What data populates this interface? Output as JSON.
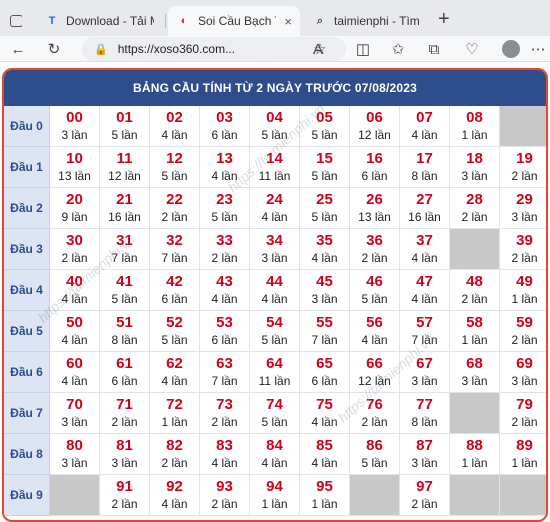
{
  "browser": {
    "tabs": [
      {
        "label": "Download - Tải M",
        "icon": "taimienphi-favicon",
        "icon_glyph": "T",
        "active": false
      },
      {
        "label": "Soi Cầu Bạch Thủ",
        "icon": "xoso-favicon",
        "icon_glyph": "◐",
        "active": true
      },
      {
        "label": "taimienphi - Tìm k",
        "icon": "search-favicon",
        "icon_glyph": "⌕",
        "active": false
      }
    ],
    "close_glyph": "×",
    "new_tab_glyph": "+",
    "address_url": "https://xoso360.com...",
    "lock_glyph": "🔒"
  },
  "table": {
    "title": "BẢNG CẦU TÍNH TỪ 2 NGÀY TRƯỚC 07/08/2023",
    "rows": [
      {
        "head": "Đầu 0",
        "cells": [
          {
            "num": "00",
            "cnt": "3 lần"
          },
          {
            "num": "01",
            "cnt": "5 lần"
          },
          {
            "num": "02",
            "cnt": "4 lần"
          },
          {
            "num": "03",
            "cnt": "6 lần"
          },
          {
            "num": "04",
            "cnt": "5 lần"
          },
          {
            "num": "05",
            "cnt": "5 lần"
          },
          {
            "num": "06",
            "cnt": "12 lần"
          },
          {
            "num": "07",
            "cnt": "4 lần"
          },
          {
            "num": "08",
            "cnt": "1 lần"
          },
          null
        ]
      },
      {
        "head": "Đầu 1",
        "cells": [
          {
            "num": "10",
            "cnt": "13 lần"
          },
          {
            "num": "11",
            "cnt": "12 lần"
          },
          {
            "num": "12",
            "cnt": "5 lần"
          },
          {
            "num": "13",
            "cnt": "4 lần"
          },
          {
            "num": "14",
            "cnt": "11 lần"
          },
          {
            "num": "15",
            "cnt": "5 lần"
          },
          {
            "num": "16",
            "cnt": "6 lần"
          },
          {
            "num": "17",
            "cnt": "8 lần"
          },
          {
            "num": "18",
            "cnt": "3 lần"
          },
          {
            "num": "19",
            "cnt": "2 lần"
          }
        ]
      },
      {
        "head": "Đầu 2",
        "cells": [
          {
            "num": "20",
            "cnt": "9 lần"
          },
          {
            "num": "21",
            "cnt": "16 lần"
          },
          {
            "num": "22",
            "cnt": "2 lần"
          },
          {
            "num": "23",
            "cnt": "5 lần"
          },
          {
            "num": "24",
            "cnt": "4 lần"
          },
          {
            "num": "25",
            "cnt": "5 lần"
          },
          {
            "num": "26",
            "cnt": "13 lần"
          },
          {
            "num": "27",
            "cnt": "16 lần"
          },
          {
            "num": "28",
            "cnt": "2 lần"
          },
          {
            "num": "29",
            "cnt": "3 lần"
          }
        ]
      },
      {
        "head": "Đầu 3",
        "cells": [
          {
            "num": "30",
            "cnt": "2 lần"
          },
          {
            "num": "31",
            "cnt": "7 lần"
          },
          {
            "num": "32",
            "cnt": "7 lần"
          },
          {
            "num": "33",
            "cnt": "2 lần"
          },
          {
            "num": "34",
            "cnt": "3 lần"
          },
          {
            "num": "35",
            "cnt": "4 lần"
          },
          {
            "num": "36",
            "cnt": "2 lần"
          },
          {
            "num": "37",
            "cnt": "4 lần"
          },
          null,
          {
            "num": "39",
            "cnt": "2 lần"
          }
        ]
      },
      {
        "head": "Đầu 4",
        "cells": [
          {
            "num": "40",
            "cnt": "4 lần"
          },
          {
            "num": "41",
            "cnt": "5 lần"
          },
          {
            "num": "42",
            "cnt": "6 lần"
          },
          {
            "num": "43",
            "cnt": "4 lần"
          },
          {
            "num": "44",
            "cnt": "4 lần"
          },
          {
            "num": "45",
            "cnt": "3 lần"
          },
          {
            "num": "46",
            "cnt": "5 lần"
          },
          {
            "num": "47",
            "cnt": "4 lần"
          },
          {
            "num": "48",
            "cnt": "2 lần"
          },
          {
            "num": "49",
            "cnt": "1 lần"
          }
        ]
      },
      {
        "head": "Đầu 5",
        "cells": [
          {
            "num": "50",
            "cnt": "4 lần"
          },
          {
            "num": "51",
            "cnt": "8 lần"
          },
          {
            "num": "52",
            "cnt": "5 lần"
          },
          {
            "num": "53",
            "cnt": "6 lần"
          },
          {
            "num": "54",
            "cnt": "5 lần"
          },
          {
            "num": "55",
            "cnt": "7 lần"
          },
          {
            "num": "56",
            "cnt": "4 lần"
          },
          {
            "num": "57",
            "cnt": "7 lần"
          },
          {
            "num": "58",
            "cnt": "1 lần"
          },
          {
            "num": "59",
            "cnt": "2 lần"
          }
        ]
      },
      {
        "head": "Đầu 6",
        "cells": [
          {
            "num": "60",
            "cnt": "4 lần"
          },
          {
            "num": "61",
            "cnt": "6 lần"
          },
          {
            "num": "62",
            "cnt": "4 lần"
          },
          {
            "num": "63",
            "cnt": "7 lần"
          },
          {
            "num": "64",
            "cnt": "11 lần"
          },
          {
            "num": "65",
            "cnt": "6 lần"
          },
          {
            "num": "66",
            "cnt": "12 lần"
          },
          {
            "num": "67",
            "cnt": "3 lần"
          },
          {
            "num": "68",
            "cnt": "3 lần"
          },
          {
            "num": "69",
            "cnt": "3 lần"
          }
        ]
      },
      {
        "head": "Đầu 7",
        "cells": [
          {
            "num": "70",
            "cnt": "3 lần"
          },
          {
            "num": "71",
            "cnt": "2 lần"
          },
          {
            "num": "72",
            "cnt": "1 lần"
          },
          {
            "num": "73",
            "cnt": "2 lần"
          },
          {
            "num": "74",
            "cnt": "5 lần"
          },
          {
            "num": "75",
            "cnt": "4 lần"
          },
          {
            "num": "76",
            "cnt": "2 lần"
          },
          {
            "num": "77",
            "cnt": "8 lần"
          },
          null,
          {
            "num": "79",
            "cnt": "2 lần"
          }
        ]
      },
      {
        "head": "Đầu 8",
        "cells": [
          {
            "num": "80",
            "cnt": "3 lần"
          },
          {
            "num": "81",
            "cnt": "3 lần"
          },
          {
            "num": "82",
            "cnt": "2 lần"
          },
          {
            "num": "83",
            "cnt": "4 lần"
          },
          {
            "num": "84",
            "cnt": "4 lần"
          },
          {
            "num": "85",
            "cnt": "4 lần"
          },
          {
            "num": "86",
            "cnt": "5 lần"
          },
          {
            "num": "87",
            "cnt": "3 lần"
          },
          {
            "num": "88",
            "cnt": "1 lần"
          },
          {
            "num": "89",
            "cnt": "1 lần"
          }
        ]
      },
      {
        "head": "Đầu 9",
        "cells": [
          null,
          {
            "num": "91",
            "cnt": "2 lần"
          },
          {
            "num": "92",
            "cnt": "4 lần"
          },
          {
            "num": "93",
            "cnt": "2 lần"
          },
          {
            "num": "94",
            "cnt": "1 lần"
          },
          {
            "num": "95",
            "cnt": "1 lần"
          },
          null,
          {
            "num": "97",
            "cnt": "2 lần"
          },
          null,
          null
        ]
      }
    ]
  }
}
